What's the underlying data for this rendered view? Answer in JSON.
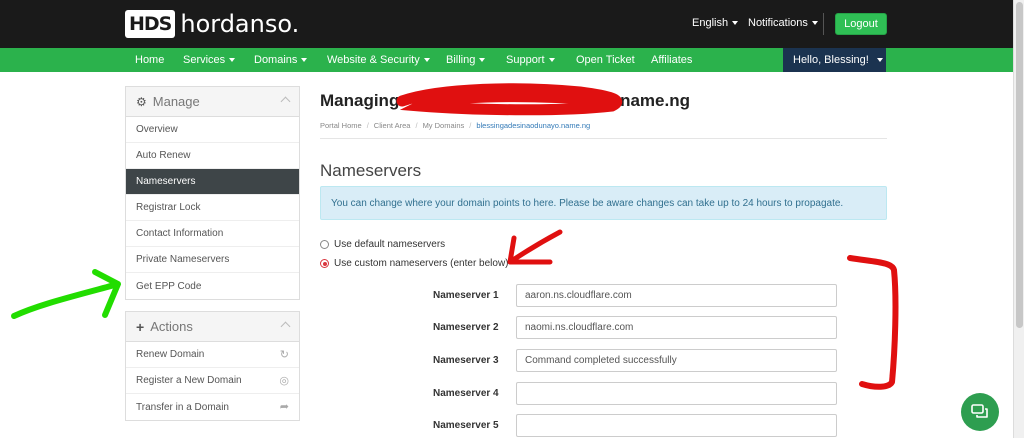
{
  "brand": {
    "mark": "HDS",
    "name": "hordanso."
  },
  "topbar": {
    "language": "English",
    "notifications": "Notifications",
    "logout": "Logout"
  },
  "nav": {
    "items": [
      "Home",
      "Services",
      "Domains",
      "Website & Security",
      "Billing",
      "Support",
      "Open Ticket",
      "Affiliates"
    ],
    "greeting": "Hello, Blessing!"
  },
  "sidebar": {
    "manage": {
      "title": "Manage",
      "items": [
        "Overview",
        "Auto Renew",
        "Nameservers",
        "Registrar Lock",
        "Contact Information",
        "Private Nameservers",
        "Get EPP Code"
      ],
      "active_index": 2
    },
    "actions": {
      "title": "Actions",
      "items": [
        "Renew Domain",
        "Register a New Domain",
        "Transfer in a Domain"
      ]
    }
  },
  "main": {
    "title_prefix": "Managing ",
    "title_suffix": "name.ng",
    "breadcrumb": [
      "Portal Home",
      "Client Area",
      "My Domains",
      "blessingadesinaodunayo.name.ng"
    ],
    "section_title": "Nameservers",
    "alert": "You can change where your domain points to here. Please be aware changes can take up to 24 hours to propagate.",
    "radio_default": "Use default nameservers",
    "radio_custom": "Use custom nameservers (enter below)",
    "selected_option": "custom",
    "nameservers": [
      {
        "label": "Nameserver 1",
        "value": "aaron.ns.cloudflare.com"
      },
      {
        "label": "Nameserver 2",
        "value": "naomi.ns.cloudflare.com"
      },
      {
        "label": "Nameserver 3",
        "value": "Command completed successfully"
      },
      {
        "label": "Nameserver 4",
        "value": ""
      },
      {
        "label": "Nameserver 5",
        "value": ""
      }
    ]
  },
  "colors": {
    "topbar": "#1a1a1a",
    "nav": "#2bb24c",
    "greeting_bg": "#1b3350",
    "logout": "#2fbf55",
    "active_item": "#3e4548",
    "alert_bg": "#d9edf7",
    "annotation_red": "#e01010",
    "annotation_green": "#22dd00"
  },
  "icons": {
    "manage": "gear-icon",
    "actions": "plus-icon",
    "renew": "refresh-icon",
    "register": "globe-icon",
    "transfer": "share-arrow-icon",
    "chat": "chat-icon"
  }
}
